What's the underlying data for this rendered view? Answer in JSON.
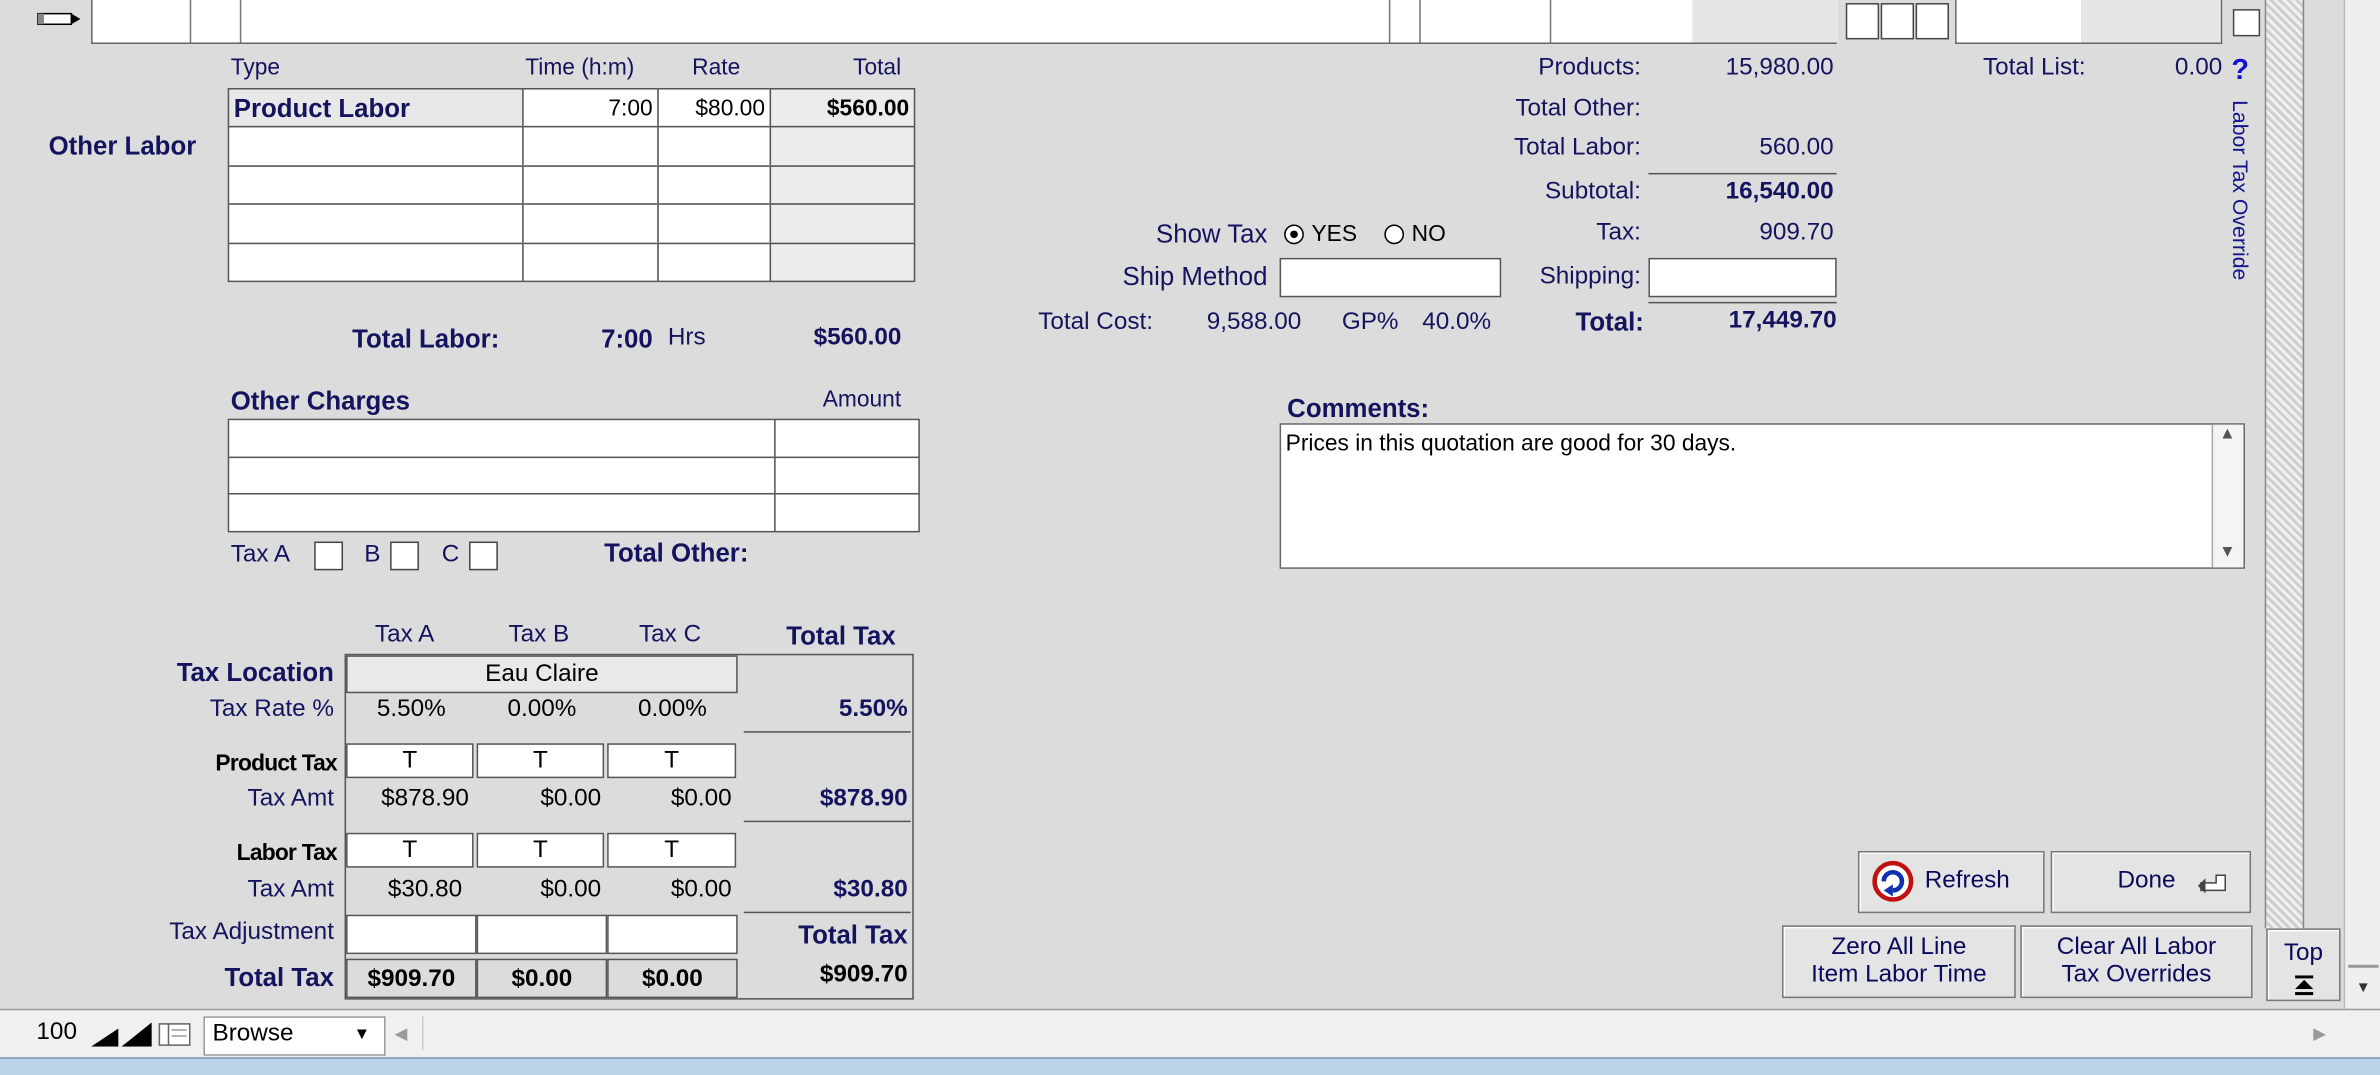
{
  "labor": {
    "section_label": "Other Labor",
    "headers": {
      "type": "Type",
      "time": "Time (h:m)",
      "rate": "Rate",
      "total": "Total"
    },
    "rows": [
      {
        "type": "Product Labor",
        "time": "7:00",
        "rate": "$80.00",
        "total": "$560.00"
      },
      {
        "type": "",
        "time": "",
        "rate": "",
        "total": ""
      },
      {
        "type": "",
        "time": "",
        "rate": "",
        "total": ""
      },
      {
        "type": "",
        "time": "",
        "rate": "",
        "total": ""
      },
      {
        "type": "",
        "time": "",
        "rate": "",
        "total": ""
      }
    ],
    "total_label": "Total Labor:",
    "total_time": "7:00",
    "hrs": "Hrs",
    "total_amount": "$560.00"
  },
  "charges": {
    "title": "Other Charges",
    "amount_header": "Amount",
    "rows": [
      {
        "desc": "",
        "amount": ""
      },
      {
        "desc": "",
        "amount": ""
      },
      {
        "desc": "",
        "amount": ""
      }
    ],
    "tax_a": "Tax A",
    "tax_b": "B",
    "tax_c": "C",
    "total_label": "Total Other:"
  },
  "tax": {
    "headers": {
      "a": "Tax A",
      "b": "Tax B",
      "c": "Tax C",
      "total": "Total Tax"
    },
    "location_label": "Tax Location",
    "location_value": "Eau Claire",
    "rate_label": "Tax Rate %",
    "rates": [
      "5.50%",
      "0.00%",
      "0.00%"
    ],
    "rate_total": "5.50%",
    "product_tax_label": "Product Tax",
    "product_flags": [
      "T",
      "T",
      "T"
    ],
    "tax_amt_label": "Tax Amt",
    "product_amts": [
      "$878.90",
      "$0.00",
      "$0.00"
    ],
    "product_total": "$878.90",
    "labor_tax_label": "Labor Tax",
    "labor_flags": [
      "T",
      "T",
      "T"
    ],
    "labor_amts": [
      "$30.80",
      "$0.00",
      "$0.00"
    ],
    "labor_total": "$30.80",
    "adjustment_label": "Tax Adjustment",
    "adjustment_total_label": "Total Tax",
    "total_label": "Total Tax",
    "totals": [
      "$909.70",
      "$0.00",
      "$0.00"
    ],
    "grand_total": "$909.70"
  },
  "summary": {
    "products_label": "Products:",
    "products": "15,980.00",
    "total_other_label": "Total Other:",
    "total_other": "",
    "total_labor_label": "Total Labor:",
    "total_labor": "560.00",
    "subtotal_label": "Subtotal:",
    "subtotal": "16,540.00",
    "tax_label": "Tax:",
    "tax": "909.70",
    "shipping_label": "Shipping:",
    "shipping": "",
    "total_label": "Total:",
    "total": "17,449.70",
    "total_list_label": "Total List:",
    "total_list": "0.00",
    "help_icon": "?"
  },
  "show_tax": {
    "label": "Show Tax",
    "yes": "YES",
    "no": "NO",
    "selected": "YES"
  },
  "ship_method": {
    "label": "Ship Method",
    "value": ""
  },
  "cost": {
    "label": "Total Cost:",
    "value": "9,588.00",
    "gp_label": "GP%",
    "gp_value": "40.0%"
  },
  "comments": {
    "label": "Comments:",
    "text": "Prices in this quotation are good for 30 days."
  },
  "vertical_label": "Labor Tax Override",
  "buttons": {
    "refresh": "Refresh",
    "done": "Done",
    "zero_line1": "Zero All Line",
    "zero_line2": "Item Labor Time",
    "clear_line1": "Clear All Labor",
    "clear_line2": "Tax Overrides",
    "top": "Top"
  },
  "status_bar": {
    "zoom": "100",
    "mode": "Browse"
  },
  "icons": {
    "pencil": "pencil-icon",
    "refresh": "refresh-icon",
    "done": "return-arrow-icon",
    "top": "arrow-to-top-icon"
  }
}
